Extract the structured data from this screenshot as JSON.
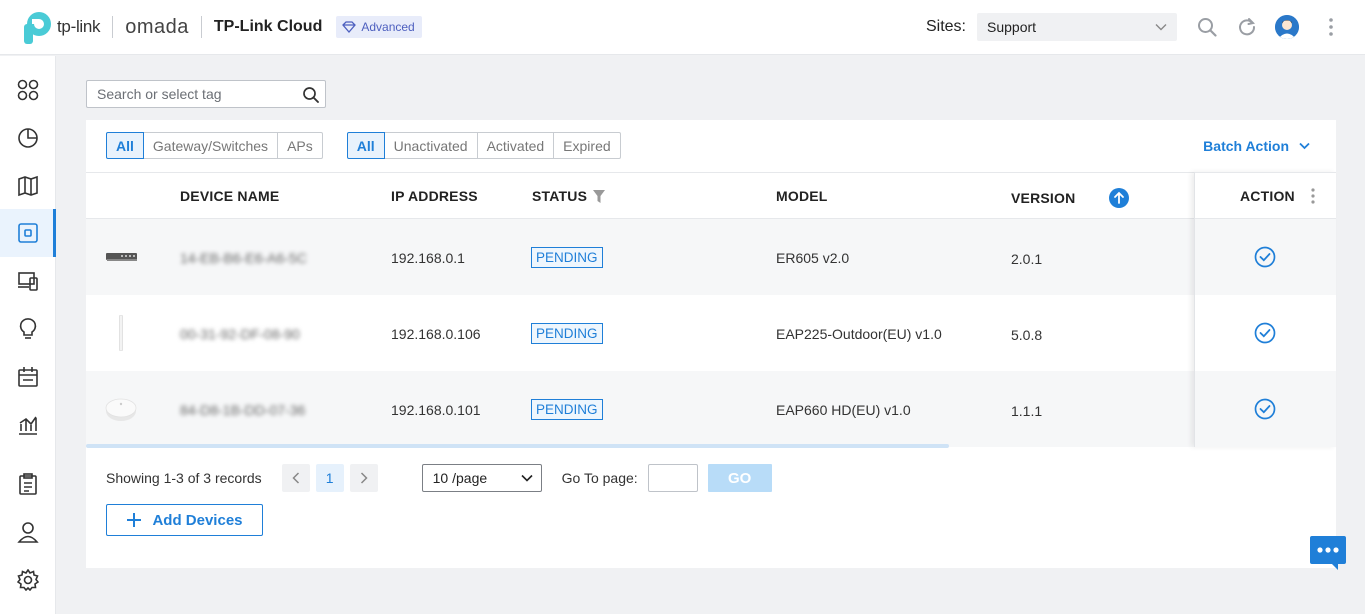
{
  "header": {
    "tp_link": "tp-link",
    "omada": "omada",
    "title": "TP-Link Cloud",
    "badge": "Advanced",
    "sites_label": "Sites:",
    "site_value": "Support"
  },
  "search": {
    "placeholder": "Search or select tag"
  },
  "filters": {
    "type": [
      {
        "label": "All",
        "selected": true
      },
      {
        "label": "Gateway/Switches",
        "selected": false
      },
      {
        "label": "APs",
        "selected": false
      }
    ],
    "status": [
      {
        "label": "All",
        "selected": true
      },
      {
        "label": "Unactivated",
        "selected": false
      },
      {
        "label": "Activated",
        "selected": false
      },
      {
        "label": "Expired",
        "selected": false
      }
    ],
    "batch_action": "Batch Action"
  },
  "table": {
    "columns": {
      "device_name": "DEVICE NAME",
      "ip_address": "IP ADDRESS",
      "status": "STATUS",
      "model": "MODEL",
      "version": "VERSION",
      "action": "ACTION"
    },
    "rows": [
      {
        "name": "14-EB-B6-E6-A6-5C",
        "ip": "192.168.0.1",
        "status": "PENDING",
        "model": "ER605 v2.0",
        "version": "2.0.1"
      },
      {
        "name": "00-31-92-DF-08-90",
        "ip": "192.168.0.106",
        "status": "PENDING",
        "model": "EAP225-Outdoor(EU) v1.0",
        "version": "5.0.8"
      },
      {
        "name": "84-D8-1B-DD-07-36",
        "ip": "192.168.0.101",
        "status": "PENDING",
        "model": "EAP660 HD(EU) v1.0",
        "version": "1.1.1"
      }
    ]
  },
  "pagination": {
    "showing": "Showing 1-3 of 3 records",
    "current_page": "1",
    "per_page": "10 /page",
    "goto_label": "Go To page:",
    "go": "GO"
  },
  "add_devices": "Add Devices",
  "colors": {
    "accent": "#1f7fd8",
    "brand_green": "#4acbd6"
  }
}
